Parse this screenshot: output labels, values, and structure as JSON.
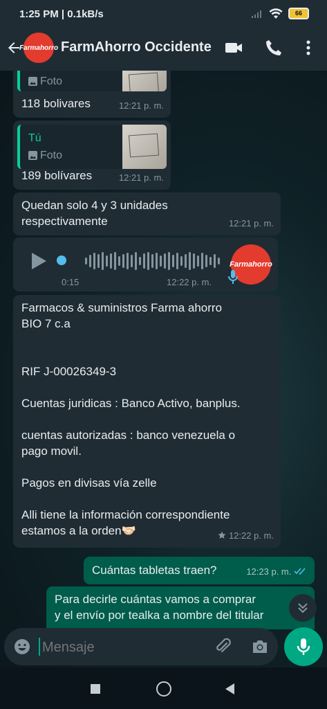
{
  "status_bar": {
    "time": "1:25 PM | 0.1kB/s",
    "battery": "66"
  },
  "header": {
    "title": "FarmAhorro Occidente",
    "avatar_text": "Farmahorro"
  },
  "messages": [
    {
      "quote_label": "Foto",
      "text": "118 bolivares",
      "time": "12:21 p. m."
    },
    {
      "quote_author": "Tú",
      "quote_label": "Foto",
      "text": "189 bolívares",
      "time": "12:21 p. m."
    },
    {
      "text_lines": [
        "Quedan solo 4 y 3 unidades",
        "respectivamente"
      ],
      "time": "12:21 p. m."
    },
    {
      "type": "voice",
      "duration": "0:15",
      "time": "12:22 p. m.",
      "avatar_text": "Farmahorro"
    },
    {
      "lines": [
        "Farmacos & suministros Farma ahorro",
        "BIO 7 c.a",
        "RIF J-00026349-3",
        "Cuentas juridicas : Banco Activo, banplus.",
        "cuentas autorizadas :  banco venezuela  o",
        "pago movil.",
        "Pagos en divisas vía zelle",
        "Alli tiene la información correspondiente",
        "estamos a la orden🤝🏻"
      ],
      "time": "12:22 p. m."
    },
    {
      "text": "Cuántas tabletas traen?",
      "time": "12:23 p. m."
    },
    {
      "lines": [
        "Para decirle cuántas vamos a comprar",
        "y el envío por tealka a nombre del titular"
      ]
    }
  ],
  "input": {
    "placeholder": "Mensaje"
  },
  "colors": {
    "accent": "#00a884",
    "outgoing": "#005c4b",
    "incoming": "#1f2c34",
    "quote_bar": "#06cf9c",
    "read_ticks": "#53bdeb"
  }
}
